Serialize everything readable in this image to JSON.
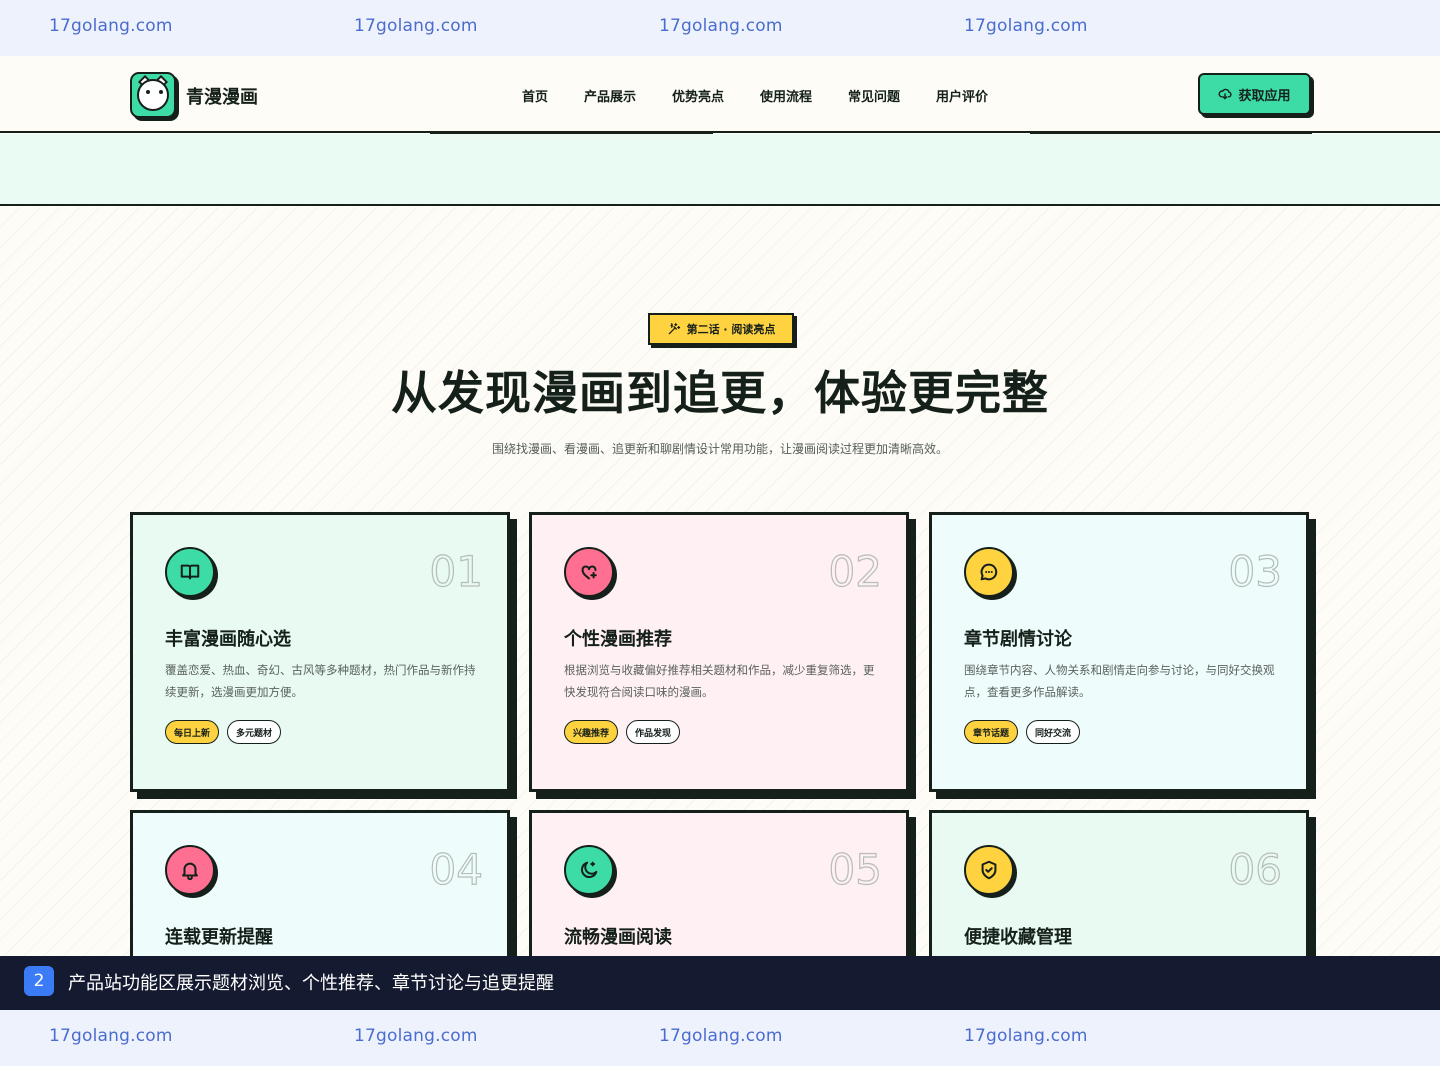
{
  "watermark": {
    "text": "17golang.com"
  },
  "header": {
    "logo_text": "青漫漫画",
    "nav": [
      "首页",
      "产品展示",
      "优势亮点",
      "使用流程",
      "常见问题",
      "用户评价"
    ],
    "cta_label": "获取应用",
    "cta_icon": "cloud-download-icon"
  },
  "section": {
    "badge": "第二话 · 阅读亮点",
    "badge_icon": "magic-wand-icon",
    "headline_part1": "从发现漫画到追更，",
    "headline_part2": "体验更完整",
    "subline": "围绕找漫画、看漫画、追更新和聊剧情设计常用功能，让漫画阅读过程更加清晰高效。"
  },
  "cards": [
    {
      "num": "01",
      "icon": "book-open-icon",
      "title": "丰富漫画随心选",
      "desc": "覆盖恋爱、热血、奇幻、古风等多种题材，热门作品与新作持续更新，选漫画更加方便。",
      "tags": [
        "每日上新",
        "多元题材"
      ]
    },
    {
      "num": "02",
      "icon": "sparkle-heart-icon",
      "title": "个性漫画推荐",
      "desc": "根据浏览与收藏偏好推荐相关题材和作品，减少重复筛选，更快发现符合阅读口味的漫画。",
      "tags": [
        "兴趣推荐",
        "作品发现"
      ]
    },
    {
      "num": "03",
      "icon": "chat-bubble-icon",
      "title": "章节剧情讨论",
      "desc": "围绕章节内容、人物关系和剧情走向参与讨论，与同好交换观点，查看更多作品解读。",
      "tags": [
        "章节话题",
        "同好交流"
      ]
    },
    {
      "num": "04",
      "icon": "bell-icon",
      "title": "连载更新提醒"
    },
    {
      "num": "05",
      "icon": "moon-star-icon",
      "title": "流畅漫画阅读"
    },
    {
      "num": "06",
      "icon": "shield-check-icon",
      "title": "便捷收藏管理"
    }
  ],
  "colors": {
    "accent": "#3ddba6",
    "yellow": "#ffd23f",
    "pink": "#ff6f91",
    "ink": "#16201b"
  },
  "caption": {
    "number": "2",
    "text": "产品站功能区展示题材浏览、个性推荐、章节讨论与追更提醒"
  }
}
